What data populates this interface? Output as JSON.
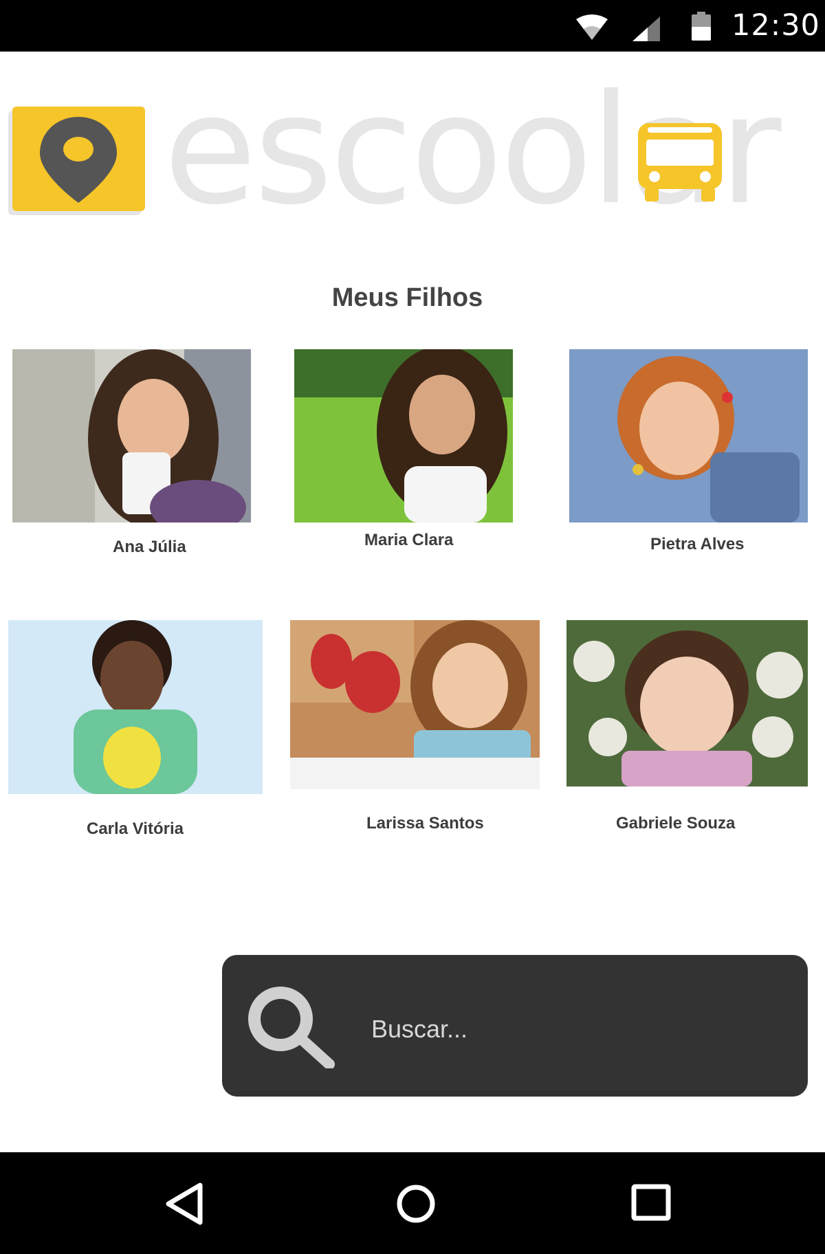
{
  "status_bar": {
    "time": "12:30"
  },
  "logo": {
    "text": "escoolar",
    "accent_color": "#f5c52a"
  },
  "page": {
    "title": "Meus Filhos"
  },
  "children": [
    {
      "name": "Ana Júlia"
    },
    {
      "name": "Maria Clara"
    },
    {
      "name": "Pietra Alves"
    },
    {
      "name": "Carla Vitória"
    },
    {
      "name": "Larissa Santos"
    },
    {
      "name": "Gabriele Souza"
    }
  ],
  "search": {
    "placeholder": "Buscar..."
  },
  "colors": {
    "search_bg": "#333333",
    "title": "#444444",
    "status_bar": "#000000"
  }
}
